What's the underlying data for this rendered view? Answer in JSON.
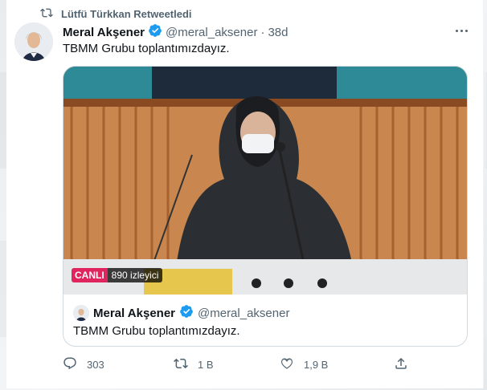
{
  "retweet": {
    "label": "Lütfü Türkkan Retweetledi"
  },
  "tweet": {
    "name": "Meral Akşener",
    "handle": "@meral_aksener",
    "dot": "·",
    "time": "38d",
    "text": "TBMM Grubu toplantımızdayız."
  },
  "quote": {
    "name": "Meral Akşener",
    "handle": "@meral_aksener",
    "text": "TBMM Grubu toplantımızdayız.",
    "live_badge": "CANLI",
    "viewers": "890 izleyici"
  },
  "actions": {
    "reply_count": "303",
    "retweet_count": "1 B",
    "like_count": "1,9 B"
  },
  "colors": {
    "accent": "#1d9bf0",
    "live": "#e0245e",
    "muted": "#536471"
  },
  "icons": [
    "retweet-icon",
    "verified-icon",
    "more-icon",
    "reply-icon",
    "like-icon",
    "share-icon"
  ]
}
